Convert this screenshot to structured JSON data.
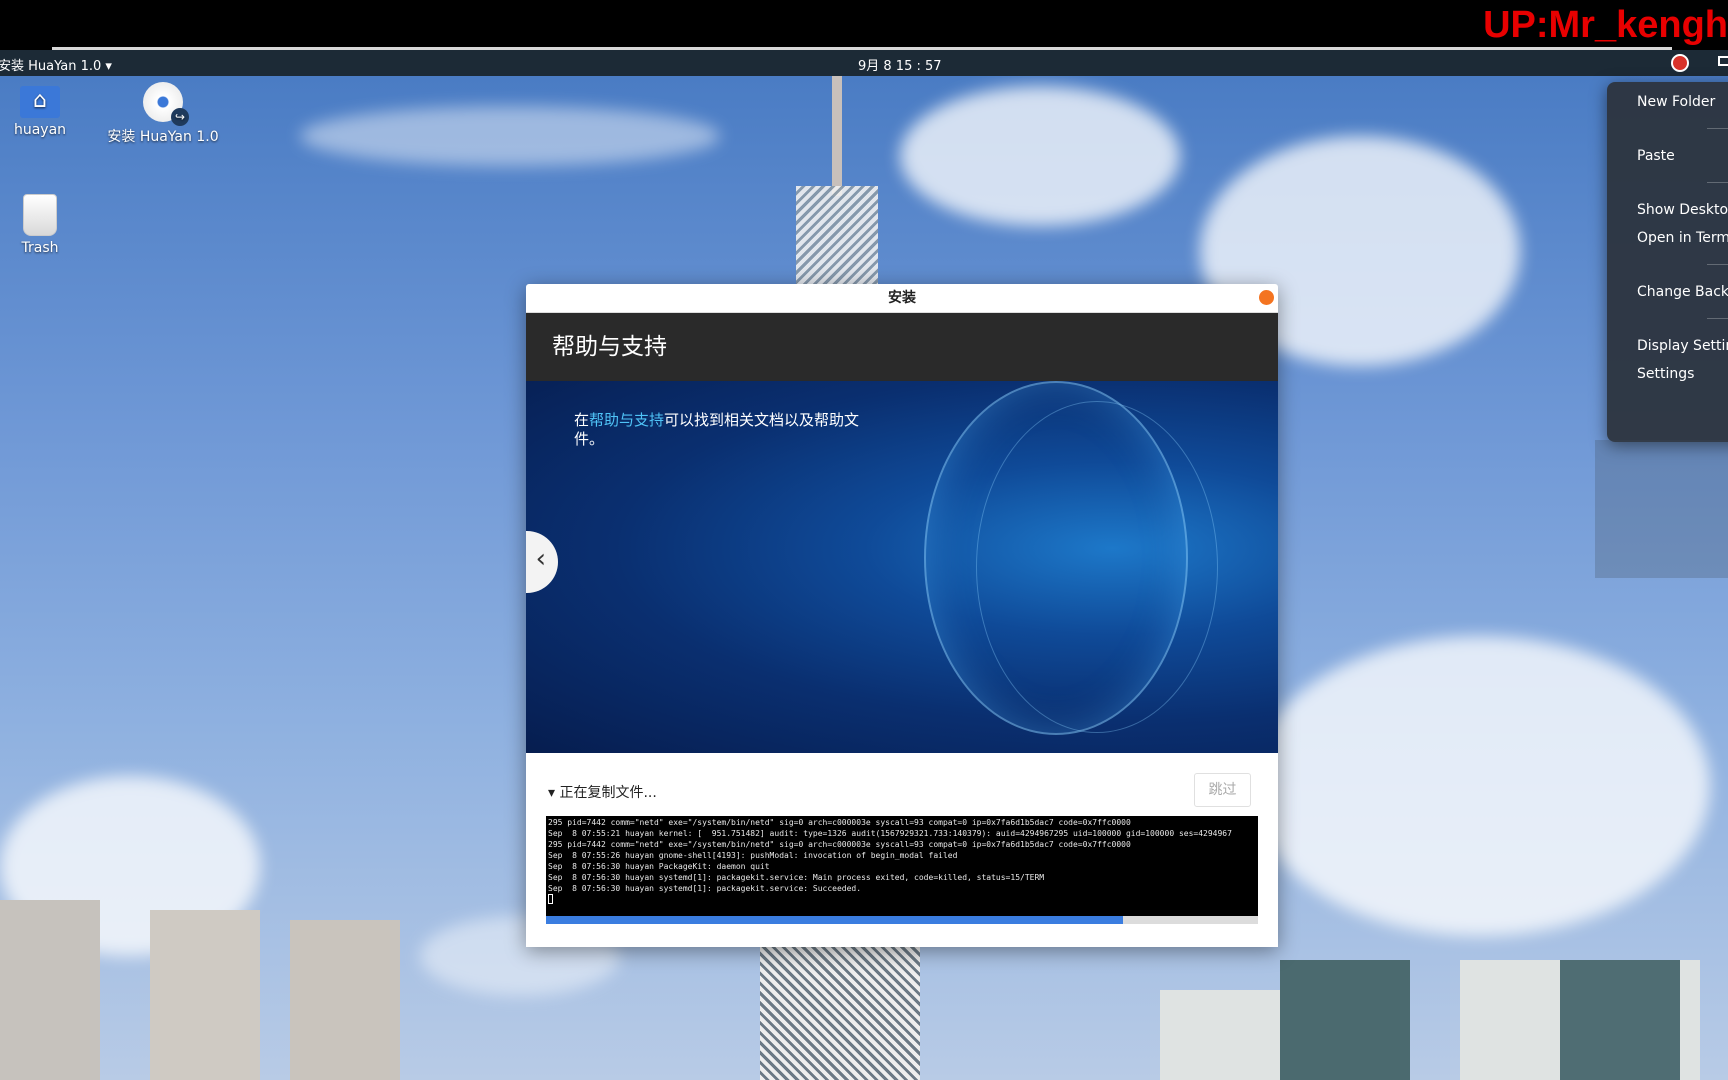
{
  "overlay": {
    "watermark": "UP:Mr_kengh"
  },
  "panel": {
    "activities": "安装 HuaYan 1.0",
    "clock": "9月 8  15 : 57"
  },
  "desktop_icons": [
    {
      "label": "huayan"
    },
    {
      "label": "安装 HuaYan 1.0"
    },
    {
      "label": "Trash"
    }
  ],
  "installer": {
    "window_title": "安装",
    "header_title": "帮助与支持",
    "slide": {
      "text_prefix": "在",
      "link_text": "帮助与支持",
      "text_suffix": "可以找到相关文档以及帮助文件。"
    },
    "status_text": "正在复制文件...",
    "skip_label": "跳过",
    "progress_fraction": 0.81,
    "log_lines": [
      "295 pid=7442 comm=\"netd\" exe=\"/system/bin/netd\" sig=0 arch=c000003e syscall=93 compat=0 ip=0x7fa6d1b5dac7 code=0x7ffc0000",
      "Sep  8 07:55:21 huayan kernel: [  951.751482] audit: type=1326 audit(1567929321.733:140379): auid=4294967295 uid=100000 gid=100000 ses=4294967",
      "295 pid=7442 comm=\"netd\" exe=\"/system/bin/netd\" sig=0 arch=c000003e syscall=93 compat=0 ip=0x7fa6d1b5dac7 code=0x7ffc0000",
      "Sep  8 07:55:26 huayan gnome-shell[4193]: pushModal: invocation of begin_modal failed",
      "Sep  8 07:56:30 huayan PackageKit: daemon quit",
      "Sep  8 07:56:30 huayan systemd[1]: packagekit.service: Main process exited, code=killed, status=15/TERM",
      "Sep  8 07:56:30 huayan systemd[1]: packagekit.service: Succeeded."
    ]
  },
  "context_menu": {
    "items": [
      "New Folder",
      "Paste",
      "Show Desktop",
      "Open in Terminal",
      "Change Background",
      "Display Settings",
      "Settings"
    ]
  },
  "icons": {
    "home": "home-folder-icon",
    "installer": "installer-disc-icon",
    "trash": "trash-icon",
    "tray": "network-indicator-icon",
    "close": "close-icon",
    "prev": "chevron-left-icon",
    "expander": "triangle-down-icon"
  },
  "colors": {
    "panel_bg": "#1c2a36",
    "accent_close": "#f47421",
    "link": "#4fc3f7",
    "progress": "#3a7de0",
    "watermark": "#e80000"
  }
}
